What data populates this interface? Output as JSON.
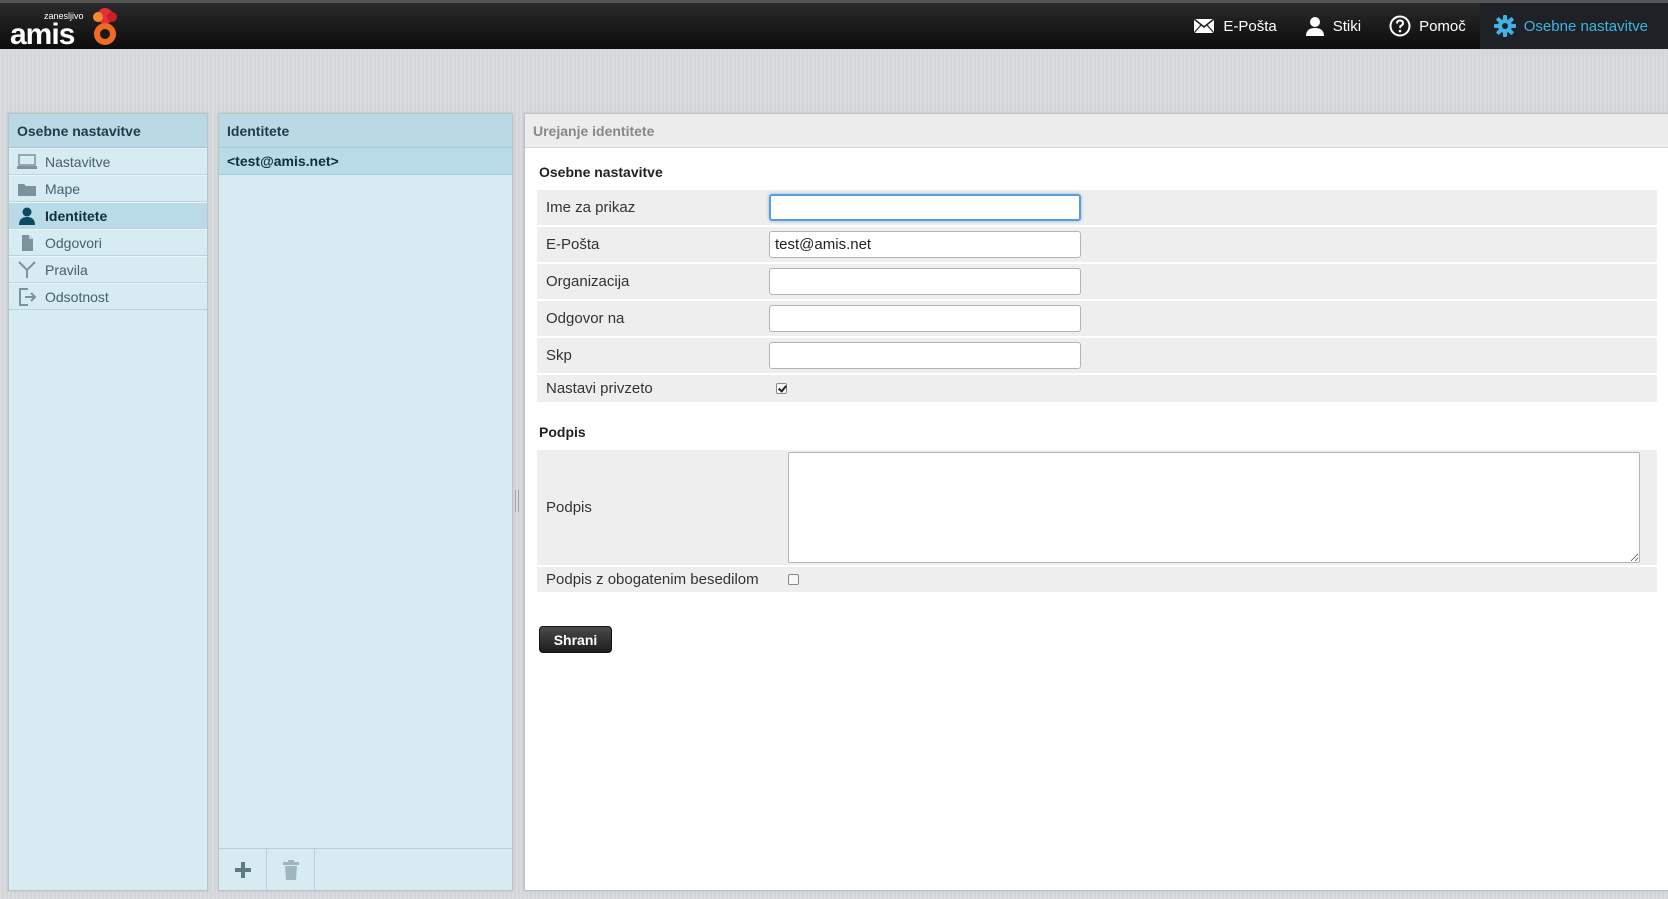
{
  "app": {
    "logo_tag": "zanesljivo",
    "logo_word": "amis"
  },
  "topnav": {
    "email": "E-Pošta",
    "contacts": "Stiki",
    "help": "Pomoč",
    "settings": "Osebne nastavitve"
  },
  "sidebar": {
    "title": "Osebne nastavitve",
    "items": [
      {
        "label": "Nastavitve",
        "icon": "monitor-icon"
      },
      {
        "label": "Mape",
        "icon": "folder-icon"
      },
      {
        "label": "Identitete",
        "icon": "person-icon",
        "selected": true
      },
      {
        "label": "Odgovori",
        "icon": "document-icon"
      },
      {
        "label": "Pravila",
        "icon": "filter-icon"
      },
      {
        "label": "Odsotnost",
        "icon": "exit-icon"
      }
    ]
  },
  "identities": {
    "title": "Identitete",
    "items": [
      "<test@amis.net>"
    ]
  },
  "editor": {
    "title": "Urejanje identitete",
    "section_settings": "Osebne nastavitve",
    "fields": {
      "display_name": {
        "label": "Ime za prikaz",
        "value": ""
      },
      "email": {
        "label": "E-Pošta",
        "value": "test@amis.net"
      },
      "organization": {
        "label": "Organizacija",
        "value": ""
      },
      "reply_to": {
        "label": "Odgovor na",
        "value": ""
      },
      "bcc": {
        "label": "Skp",
        "value": ""
      },
      "default": {
        "label": "Nastavi privzeto",
        "checked": true
      }
    },
    "section_signature": "Podpis",
    "signature": {
      "label": "Podpis",
      "value": ""
    },
    "html_signature": {
      "label": "Podpis z obogatenim besedilom",
      "checked": false
    },
    "save_label": "Shrani"
  },
  "colors": {
    "accent": "#3fb3e6",
    "logo_orange": "#f26a21",
    "logo_red": "#e5303a"
  }
}
